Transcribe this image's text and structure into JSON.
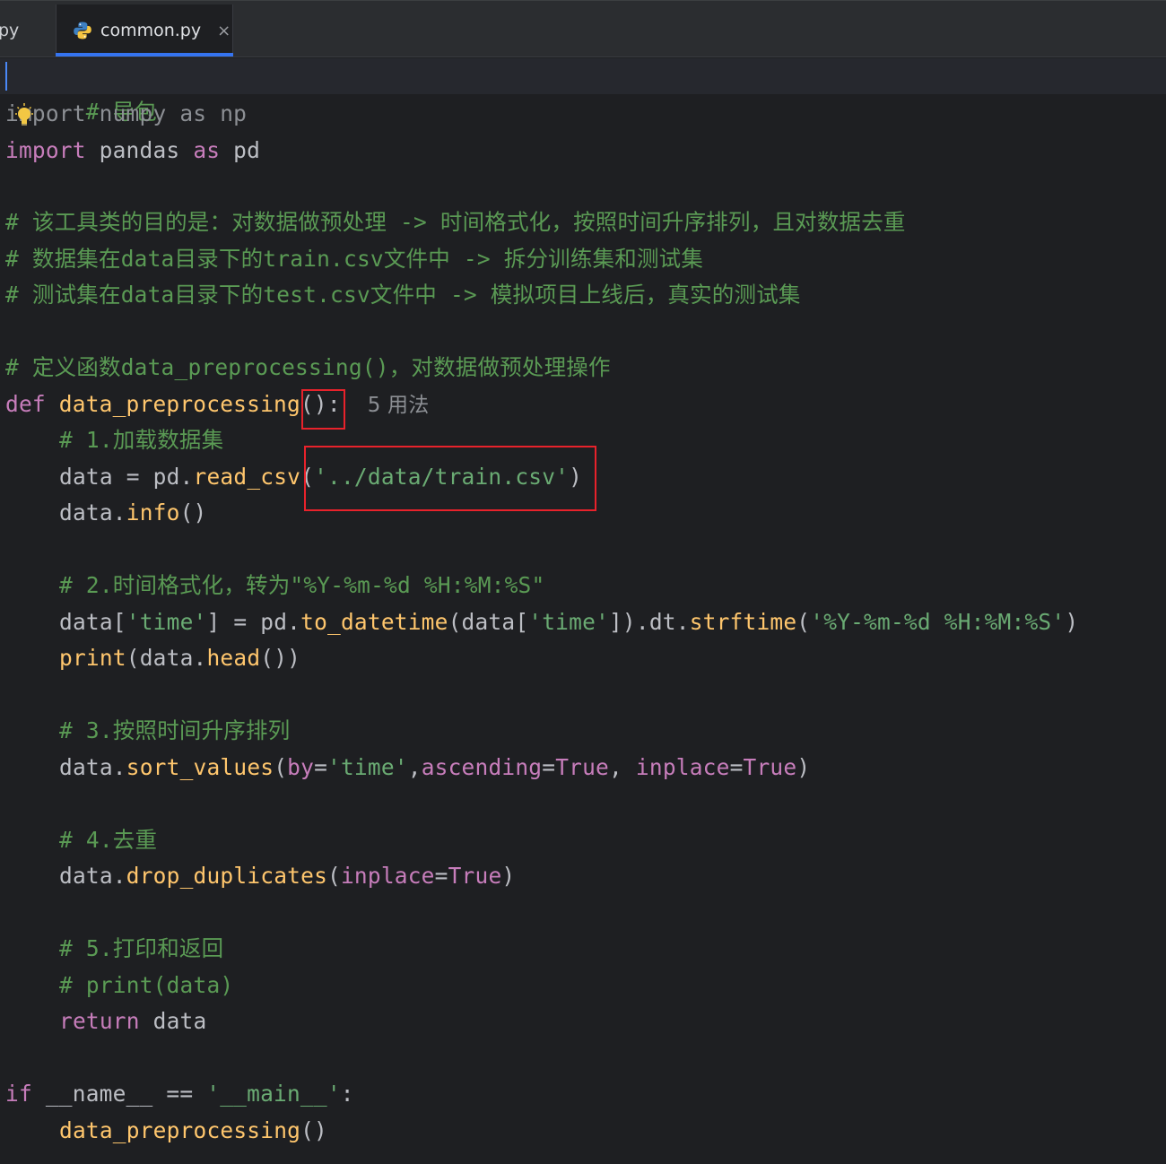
{
  "tabs": {
    "prev_label": "py",
    "active_label": "common.py",
    "close_glyph": "×"
  },
  "icons": {
    "python_file": "python-file-icon",
    "intention_bulb": "lightbulb-icon",
    "close": "close-icon"
  },
  "colors": {
    "accent": "#3574f0",
    "highlight_box": "#e8222b"
  },
  "code": {
    "l1_comment": "# 导包",
    "l2_kw": "import",
    "l2_rest": " numpy ",
    "l2_as": "as",
    "l2_alias": " np",
    "l3_kw": "import",
    "l3_rest": " pandas ",
    "l3_as": "as",
    "l3_alias": " pd",
    "l5_comment": "# 该工具类的目的是：对数据做预处理 -> 时间格式化，按照时间升序排列，且对数据去重",
    "l6_comment": "# 数据集在data目录下的train.csv文件中 -> 拆分训练集和测试集",
    "l7_comment": "# 测试集在data目录下的test.csv文件中 -> 模拟项目上线后，真实的测试集",
    "l9_comment": "# 定义函数data_preprocessing()，对数据做预处理操作",
    "l10_def": "def",
    "l10_name": " data_preprocessing",
    "l10_parens": "():",
    "l10_hint": "5 用法",
    "l11_comment": "# 1.加载数据集",
    "l12_a": "data = pd.",
    "l12_fn": "read_csv",
    "l12_b": "(",
    "l12_str": "'../data/train.csv'",
    "l12_c": ")",
    "l13_a": "data.",
    "l13_fn": "info",
    "l13_b": "()",
    "l15_comment": "# 2.时间格式化，转为\"%Y-%m-%d %H:%M:%S\"",
    "l16_a": "data[",
    "l16_s1": "'time'",
    "l16_b": "] = pd.",
    "l16_fn1": "to_datetime",
    "l16_c": "(data[",
    "l16_s2": "'time'",
    "l16_d": "]).dt.",
    "l16_fn2": "strftime",
    "l16_e": "(",
    "l16_s3": "'%Y-%m-%d %H:%M:%S'",
    "l16_f": ")",
    "l17_fn": "print",
    "l17_a": "(data.",
    "l17_fn2": "head",
    "l17_b": "())",
    "l19_comment": "# 3.按照时间升序排列",
    "l20_a": "data.",
    "l20_fn": "sort_values",
    "l20_b": "(",
    "l20_p1": "by",
    "l20_c": "=",
    "l20_s1": "'time'",
    "l20_d": ",",
    "l20_p2": "ascending",
    "l20_e": "=",
    "l20_v1": "True",
    "l20_f": ", ",
    "l20_p3": "inplace",
    "l20_g": "=",
    "l20_v2": "True",
    "l20_h": ")",
    "l22_comment": "# 4.去重",
    "l23_a": "data.",
    "l23_fn": "drop_duplicates",
    "l23_b": "(",
    "l23_p": "inplace",
    "l23_c": "=",
    "l23_v": "True",
    "l23_d": ")",
    "l25_comment": "# 5.打印和返回",
    "l26_comment": "# print(data)",
    "l27_kw": "return",
    "l27_rest": " data",
    "l29_kw": "if",
    "l29_a": " __name__ == ",
    "l29_str": "'__main__'",
    "l29_b": ":",
    "l30_fn": "data_preprocessing",
    "l30_a": "()"
  }
}
